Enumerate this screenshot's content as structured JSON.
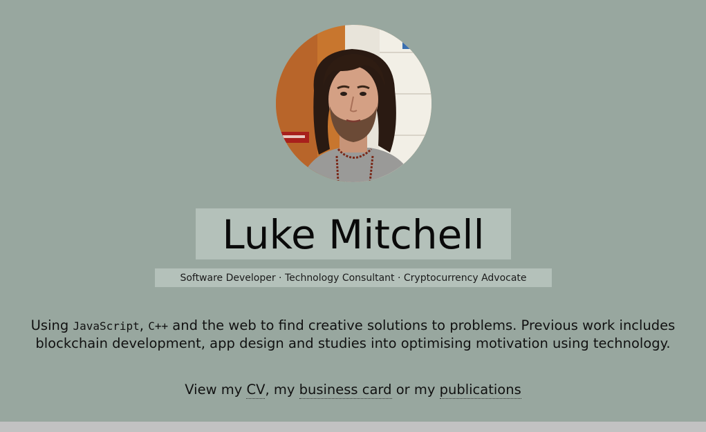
{
  "profile": {
    "photo_alt": "portrait photo",
    "name": "Luke Mitchell",
    "tagline": "Software Developer · Technology Consultant · Cryptocurrency Advocate"
  },
  "bio": {
    "lead": "Using ",
    "lang1": "JavaScript",
    "sep1": ", ",
    "lang2": "C++",
    "rest": " and the web to find creative solutions to problems. Previous work includes blockchain development, app design and studies into optimising motivation using technology."
  },
  "links": {
    "prefix": "View my ",
    "cv_label": "CV",
    "sep1": ", my ",
    "card_label": "business card",
    "sep2": " or my ",
    "publications_label": "publications"
  },
  "colors": {
    "background": "#98a79f",
    "highlight_box": "#b4c1ba",
    "footer_strip": "#c2c2c2"
  }
}
